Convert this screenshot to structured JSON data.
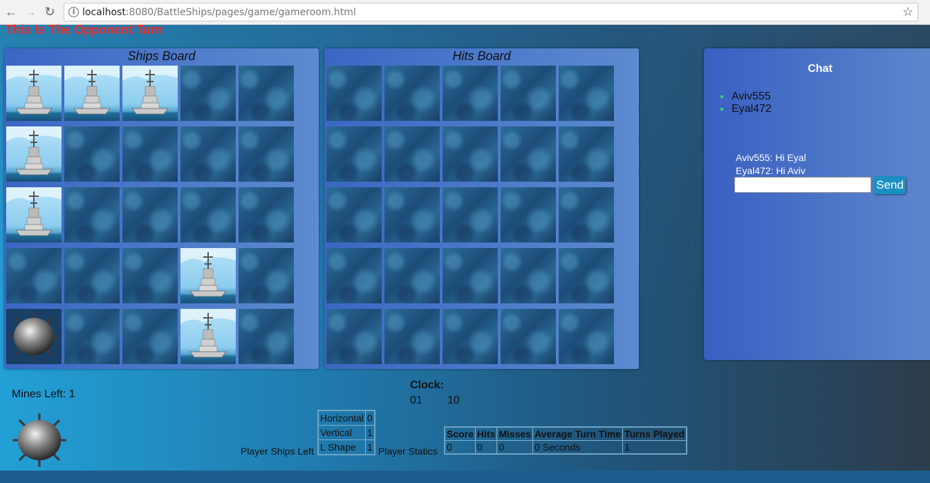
{
  "browser": {
    "url_host": "localhost",
    "url_rest": ":8080/BattleShips/pages/game/gameroom.html",
    "icons": [
      "back-arrow-icon",
      "forward-arrow-icon",
      "reload-icon",
      "info-icon",
      "star-icon"
    ]
  },
  "game": {
    "turn_message": "This Is The Opponent Turn",
    "ships_board_title": "Ships Board",
    "hits_board_title": "Hits Board",
    "ships_board": [
      [
        "ship",
        "ship",
        "ship",
        "water",
        "water"
      ],
      [
        "ship",
        "water",
        "water",
        "water",
        "water"
      ],
      [
        "ship",
        "water",
        "water",
        "water",
        "water"
      ],
      [
        "water",
        "water",
        "water",
        "ship",
        "water"
      ],
      [
        "mine",
        "water",
        "water",
        "ship",
        "water"
      ]
    ],
    "hits_board": [
      [
        "water",
        "water",
        "water",
        "water",
        "water"
      ],
      [
        "water",
        "water",
        "water",
        "water",
        "water"
      ],
      [
        "water",
        "water",
        "water",
        "water",
        "water"
      ],
      [
        "water",
        "water",
        "water",
        "water",
        "water"
      ],
      [
        "water",
        "water",
        "water",
        "water",
        "water"
      ]
    ],
    "mines_left_label": "Mines Left: 1",
    "clock": {
      "label": "Clock:",
      "minutes": "01",
      "seconds": "10"
    },
    "ships_left": {
      "label": "Player Ships Left",
      "rows": [
        {
          "type": "Horizontal",
          "count": "0"
        },
        {
          "type": "Vertical",
          "count": "1"
        },
        {
          "type": "L Shape",
          "count": "1"
        }
      ]
    },
    "statistics": {
      "label": "Player Statics",
      "headers": [
        "Score",
        "Hits",
        "Misses",
        "Average Turn Time",
        "Turns Played"
      ],
      "values": [
        "0",
        "0",
        "0",
        "0 Seconds",
        "1"
      ]
    }
  },
  "chat": {
    "title": "Chat",
    "users": [
      "Aviv555",
      "Eyal472"
    ],
    "messages": [
      "Aviv555: Hi Eyal",
      "Eyal472: Hi Aviv"
    ],
    "input_value": "",
    "send_label": "Send"
  },
  "colors": {
    "turn_message": "#ee2a2a",
    "user_online_dot": "#39d26a",
    "send_button": "#1c8fc2"
  }
}
